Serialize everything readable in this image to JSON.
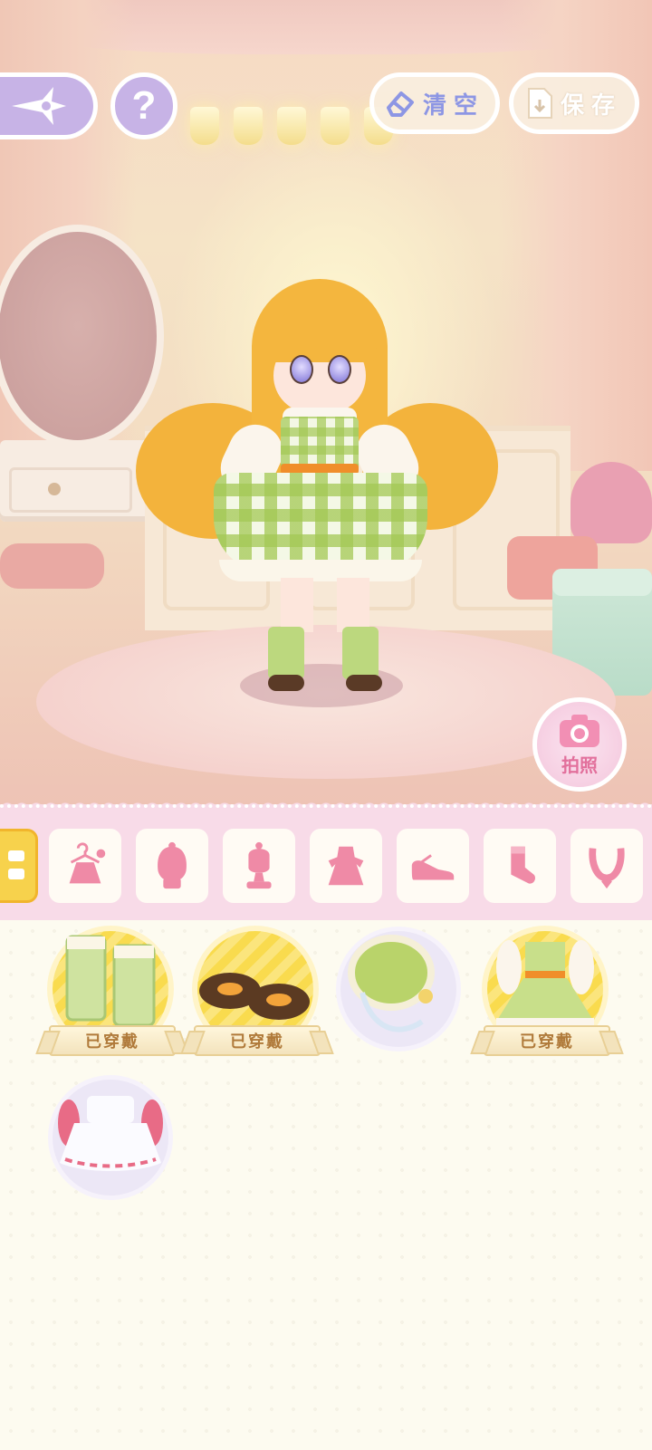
{
  "topbar": {
    "back_icon": "sparkle-back-icon",
    "help_label": "?",
    "clear_label": "清空",
    "save_label": "保存"
  },
  "photo": {
    "label": "拍照"
  },
  "categories": [
    {
      "name": "collapsed",
      "icon": "menu-handle-icon",
      "active": true
    },
    {
      "name": "outfit-sets",
      "icon": "hanger-dress-icon"
    },
    {
      "name": "hair",
      "icon": "hair-icon"
    },
    {
      "name": "headwear",
      "icon": "headwear-icon"
    },
    {
      "name": "dress",
      "icon": "dress-icon"
    },
    {
      "name": "shoes",
      "icon": "shoe-icon"
    },
    {
      "name": "socks",
      "icon": "sock-icon"
    },
    {
      "name": "necklace",
      "icon": "necklace-icon"
    }
  ],
  "items": [
    {
      "name": "green-socks",
      "status": "已穿戴",
      "worn": true
    },
    {
      "name": "brown-bow-shoes",
      "status": "已穿戴",
      "worn": true
    },
    {
      "name": "green-bonnet",
      "worn": false
    },
    {
      "name": "gingham-dress",
      "status": "已穿戴",
      "worn": true
    },
    {
      "name": "pink-white-dress",
      "worn": false
    }
  ],
  "colors": {
    "accent_purple": "#c7b3e6",
    "category_bar": "#f8dbe8",
    "worn_yellow": "#f9db4e",
    "icon_pink": "#ef8aa6"
  }
}
